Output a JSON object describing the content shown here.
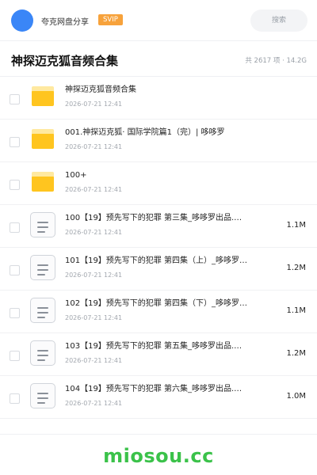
{
  "header": {
    "share_name": "夸克网盘分享",
    "svip_badge": "SVIP",
    "search_placeholder": "搜索",
    "avatar_color": "#3a86f7",
    "badge_color": "#f7a23b"
  },
  "folder": {
    "title": "神探迈克狐音频合集",
    "summary": "共 2617 项 · 14.2G"
  },
  "files": [
    {
      "type": "folder",
      "icon": "folder-icon",
      "name": "神探迈克狐音频合集",
      "date": "2026-07-21 12:41",
      "size": ""
    },
    {
      "type": "folder",
      "icon": "folder-icon",
      "name": "001.神探迈克狐· 国际学院篇1（完）| 哆哆罗",
      "date": "2026-07-21 12:41",
      "size": ""
    },
    {
      "type": "folder",
      "icon": "folder-icon",
      "name": "100+",
      "date": "2026-07-21 12:41",
      "size": ""
    },
    {
      "type": "file",
      "icon": "document-icon",
      "name": "100【19】预先写下的犯罪 第三集_哆哆罗出品.…",
      "date": "2026-07-21 12:41",
      "size": "1.1M"
    },
    {
      "type": "file",
      "icon": "document-icon",
      "name": "101【19】预先写下的犯罪 第四集（上）_哆哆罗…",
      "date": "2026-07-21 12:41",
      "size": "1.2M"
    },
    {
      "type": "file",
      "icon": "document-icon",
      "name": "102【19】预先写下的犯罪 第四集（下）_哆哆罗…",
      "date": "2026-07-21 12:41",
      "size": "1.1M"
    },
    {
      "type": "file",
      "icon": "document-icon",
      "name": "103【19】预先写下的犯罪 第五集_哆哆罗出品.…",
      "date": "2026-07-21 12:41",
      "size": "1.2M"
    },
    {
      "type": "file",
      "icon": "document-icon",
      "name": "104【19】预先写下的犯罪 第六集_哆哆罗出品.…",
      "date": "2026-07-21 12:41",
      "size": "1.0M"
    }
  ],
  "watermark": "miosou.cc",
  "colors": {
    "folder": "#ffc51f",
    "watermark": "#3bc24a"
  }
}
